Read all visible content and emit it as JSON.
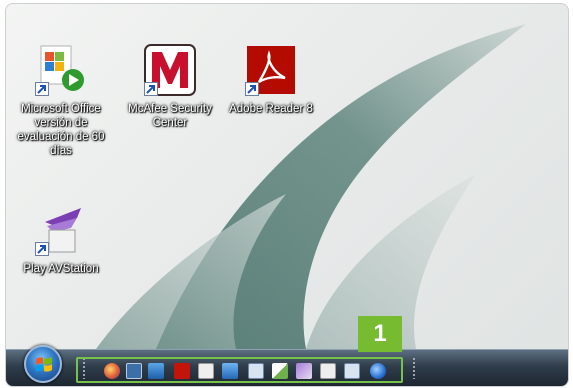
{
  "desktop": {
    "icons": [
      {
        "name": "microsoft-office",
        "label": "Microsoft Office versión de evaluación de 60 días"
      },
      {
        "name": "mcafee-security-center",
        "label": "McAfee Security Center"
      },
      {
        "name": "adobe-reader",
        "label": "Adobe Reader 8"
      },
      {
        "name": "play-avstation",
        "label": "Play AVStation"
      }
    ]
  },
  "taskbar": {
    "start_button_icon": "windows-start-orb-icon",
    "quick_launch_icons": [
      "browser-icon",
      "desktop-icon",
      "monitor-icon",
      "acrobat-icon",
      "shortcut-icon",
      "network-icon",
      "calculator-icon",
      "document-icon",
      "notes-icon",
      "shortcut-icon",
      "calculator-icon",
      "globe-icon"
    ]
  },
  "callout": {
    "number": "1",
    "color": "#77bb30"
  }
}
